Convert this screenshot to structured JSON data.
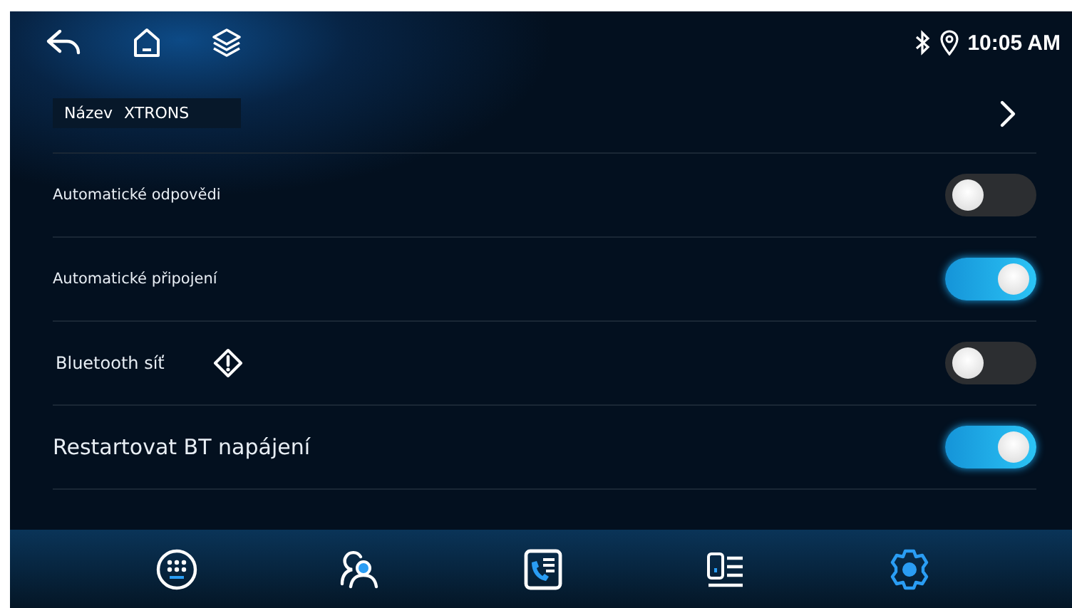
{
  "status_bar": {
    "time": "10:05 AM"
  },
  "settings": [
    {
      "kind": "link",
      "label": "Název",
      "value": "XTRONS"
    },
    {
      "kind": "toggle",
      "label": "Automatické odpovědi",
      "on": false,
      "warning": false
    },
    {
      "kind": "toggle",
      "label": "Automatické připojení",
      "on": true,
      "warning": false
    },
    {
      "kind": "toggle",
      "label": "Bluetooth síť",
      "on": false,
      "warning": true
    },
    {
      "kind": "toggle",
      "label": "Restartovat BT napájení",
      "on": true,
      "warning": false
    }
  ],
  "nav": [
    {
      "kind": "dialpad",
      "selected": false
    },
    {
      "kind": "contacts",
      "selected": false
    },
    {
      "kind": "call-log",
      "selected": false
    },
    {
      "kind": "devices",
      "selected": false
    },
    {
      "kind": "settings",
      "selected": true
    }
  ]
}
